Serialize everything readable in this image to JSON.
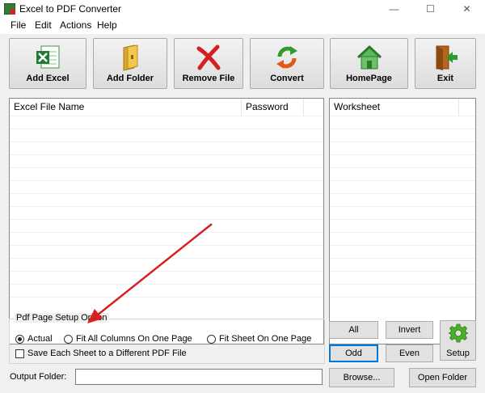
{
  "window": {
    "title": "Excel to PDF Converter",
    "minimize": "—",
    "maximize": "☐",
    "close": "✕"
  },
  "menu": [
    "File",
    "Edit",
    "Actions",
    "Help"
  ],
  "toolbar": [
    {
      "label": "Add Excel",
      "icon": "excel-icon"
    },
    {
      "label": "Add Folder",
      "icon": "folder-icon"
    },
    {
      "label": "Remove File",
      "icon": "remove-x-icon"
    },
    {
      "label": "Convert",
      "icon": "convert-arrows-icon"
    },
    {
      "label": "HomePage",
      "icon": "home-icon"
    },
    {
      "label": "Exit",
      "icon": "exit-door-icon"
    }
  ],
  "file_list": {
    "columns": [
      "Excel File Name",
      "Password"
    ],
    "rows": []
  },
  "worksheet_list": {
    "columns": [
      "Worksheet"
    ],
    "rows": []
  },
  "page_setup": {
    "title": "Pdf Page Setup Option",
    "options": [
      {
        "label": "Actual",
        "selected": true
      },
      {
        "label": "Fit All Columns On One Page",
        "selected": false
      },
      {
        "label": "Fit Sheet On One Page",
        "selected": false
      }
    ],
    "save_each_sheet": {
      "label": "Save Each Sheet to a Different PDF File",
      "checked": false
    }
  },
  "selection_buttons": {
    "all": "All",
    "invert": "Invert",
    "odd": "Odd",
    "even": "Even"
  },
  "setup_button": {
    "label": "Setup",
    "icon": "gear-icon"
  },
  "output": {
    "label": "Output Folder:",
    "value": "",
    "browse": "Browse...",
    "open_folder": "Open Folder"
  },
  "annotation": {
    "color": "#d81f1f"
  }
}
